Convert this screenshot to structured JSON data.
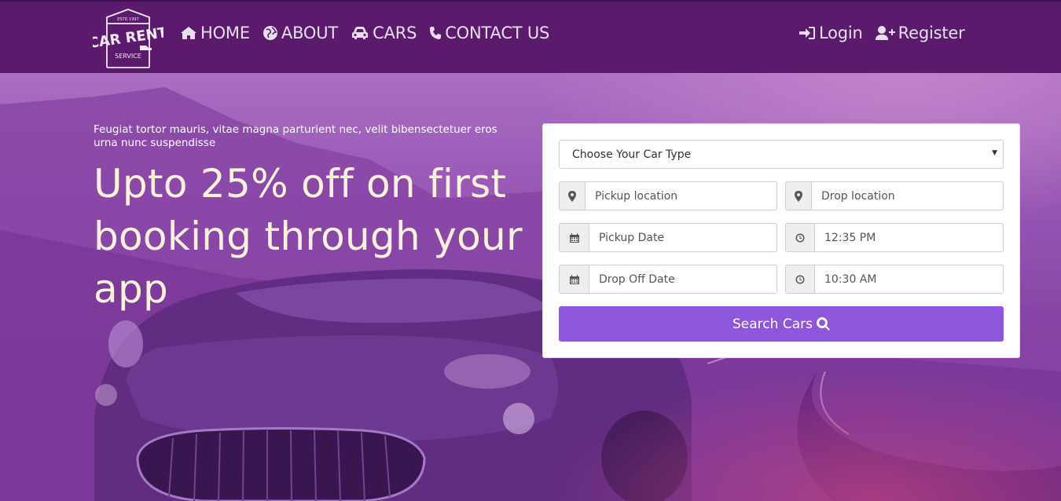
{
  "logo": {
    "top_text": "ESTD 1997",
    "main_text": "CAR RENT",
    "bottom_text": "SERVICE"
  },
  "nav": {
    "home": "HOME",
    "about": "ABOUT",
    "cars": "CARS",
    "contact": "CONTACT US",
    "login": "Login",
    "register": "Register"
  },
  "hero": {
    "subtitle": "Feugiat tortor mauris, vitae magna parturient nec, velit bibensectetuer eros urna nunc suspendisse",
    "headline": "Upto 25% off on first booking through your app"
  },
  "form": {
    "car_type": "Choose Your Car Type",
    "pickup_location": "Pickup location",
    "drop_location": "Drop location",
    "pickup_date": "Pickup Date",
    "pickup_time": "12:35 PM",
    "dropoff_date": "Drop Off Date",
    "dropoff_time": "10:30 AM",
    "search_label": "Search Cars"
  },
  "colors": {
    "navbar_bg": "#5b1a6b",
    "hero_overlay": "#7a3a9a",
    "headline_text": "#fbf3d9",
    "search_button": "#8e55dd"
  },
  "icons": [
    "home-icon",
    "globe-icon",
    "car-icon",
    "phone-icon",
    "sign-in-icon",
    "user-plus-icon",
    "map-marker-icon",
    "calendar-icon",
    "clock-icon",
    "search-icon"
  ]
}
